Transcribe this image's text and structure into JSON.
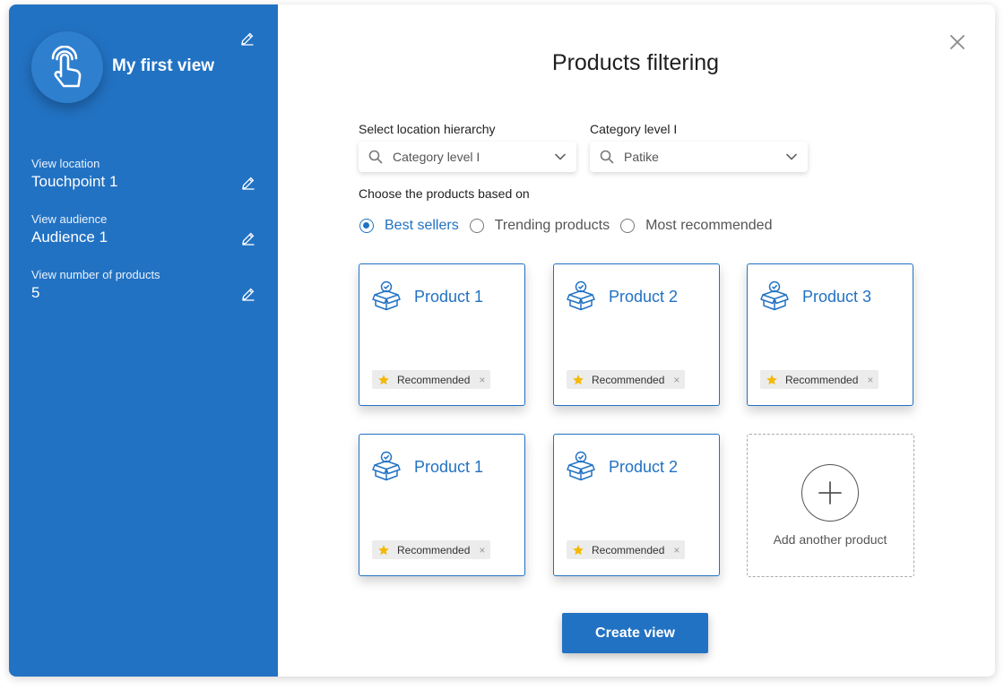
{
  "colors": {
    "accent": "#2272c3",
    "star": "#f5b800"
  },
  "sidebar": {
    "view_name": "My first view",
    "fields": [
      {
        "label": "View  location",
        "value": "Touchpoint 1"
      },
      {
        "label": "View  audience",
        "value": "Audience 1"
      },
      {
        "label": "View  number of products",
        "value": "5"
      }
    ]
  },
  "main": {
    "title": "Products filtering",
    "location_hierarchy": {
      "label": "Select location hierarchy",
      "value": "Category level I"
    },
    "category_level": {
      "label": "Category level I",
      "value": "Patike"
    },
    "choose_label": "Choose the products based on",
    "radio_options": [
      {
        "label": "Best sellers",
        "selected": true
      },
      {
        "label": "Trending products",
        "selected": false
      },
      {
        "label": "Most recommended",
        "selected": false
      }
    ],
    "products": [
      {
        "name": "Product 1",
        "tag": "Recommended"
      },
      {
        "name": "Product 2",
        "tag": "Recommended"
      },
      {
        "name": "Product 3",
        "tag": "Recommended"
      },
      {
        "name": "Product 1",
        "tag": "Recommended"
      },
      {
        "name": "Product 2",
        "tag": "Recommended"
      }
    ],
    "add_label": "Add another product",
    "create_button": "Create view",
    "chip_remove": "×"
  }
}
